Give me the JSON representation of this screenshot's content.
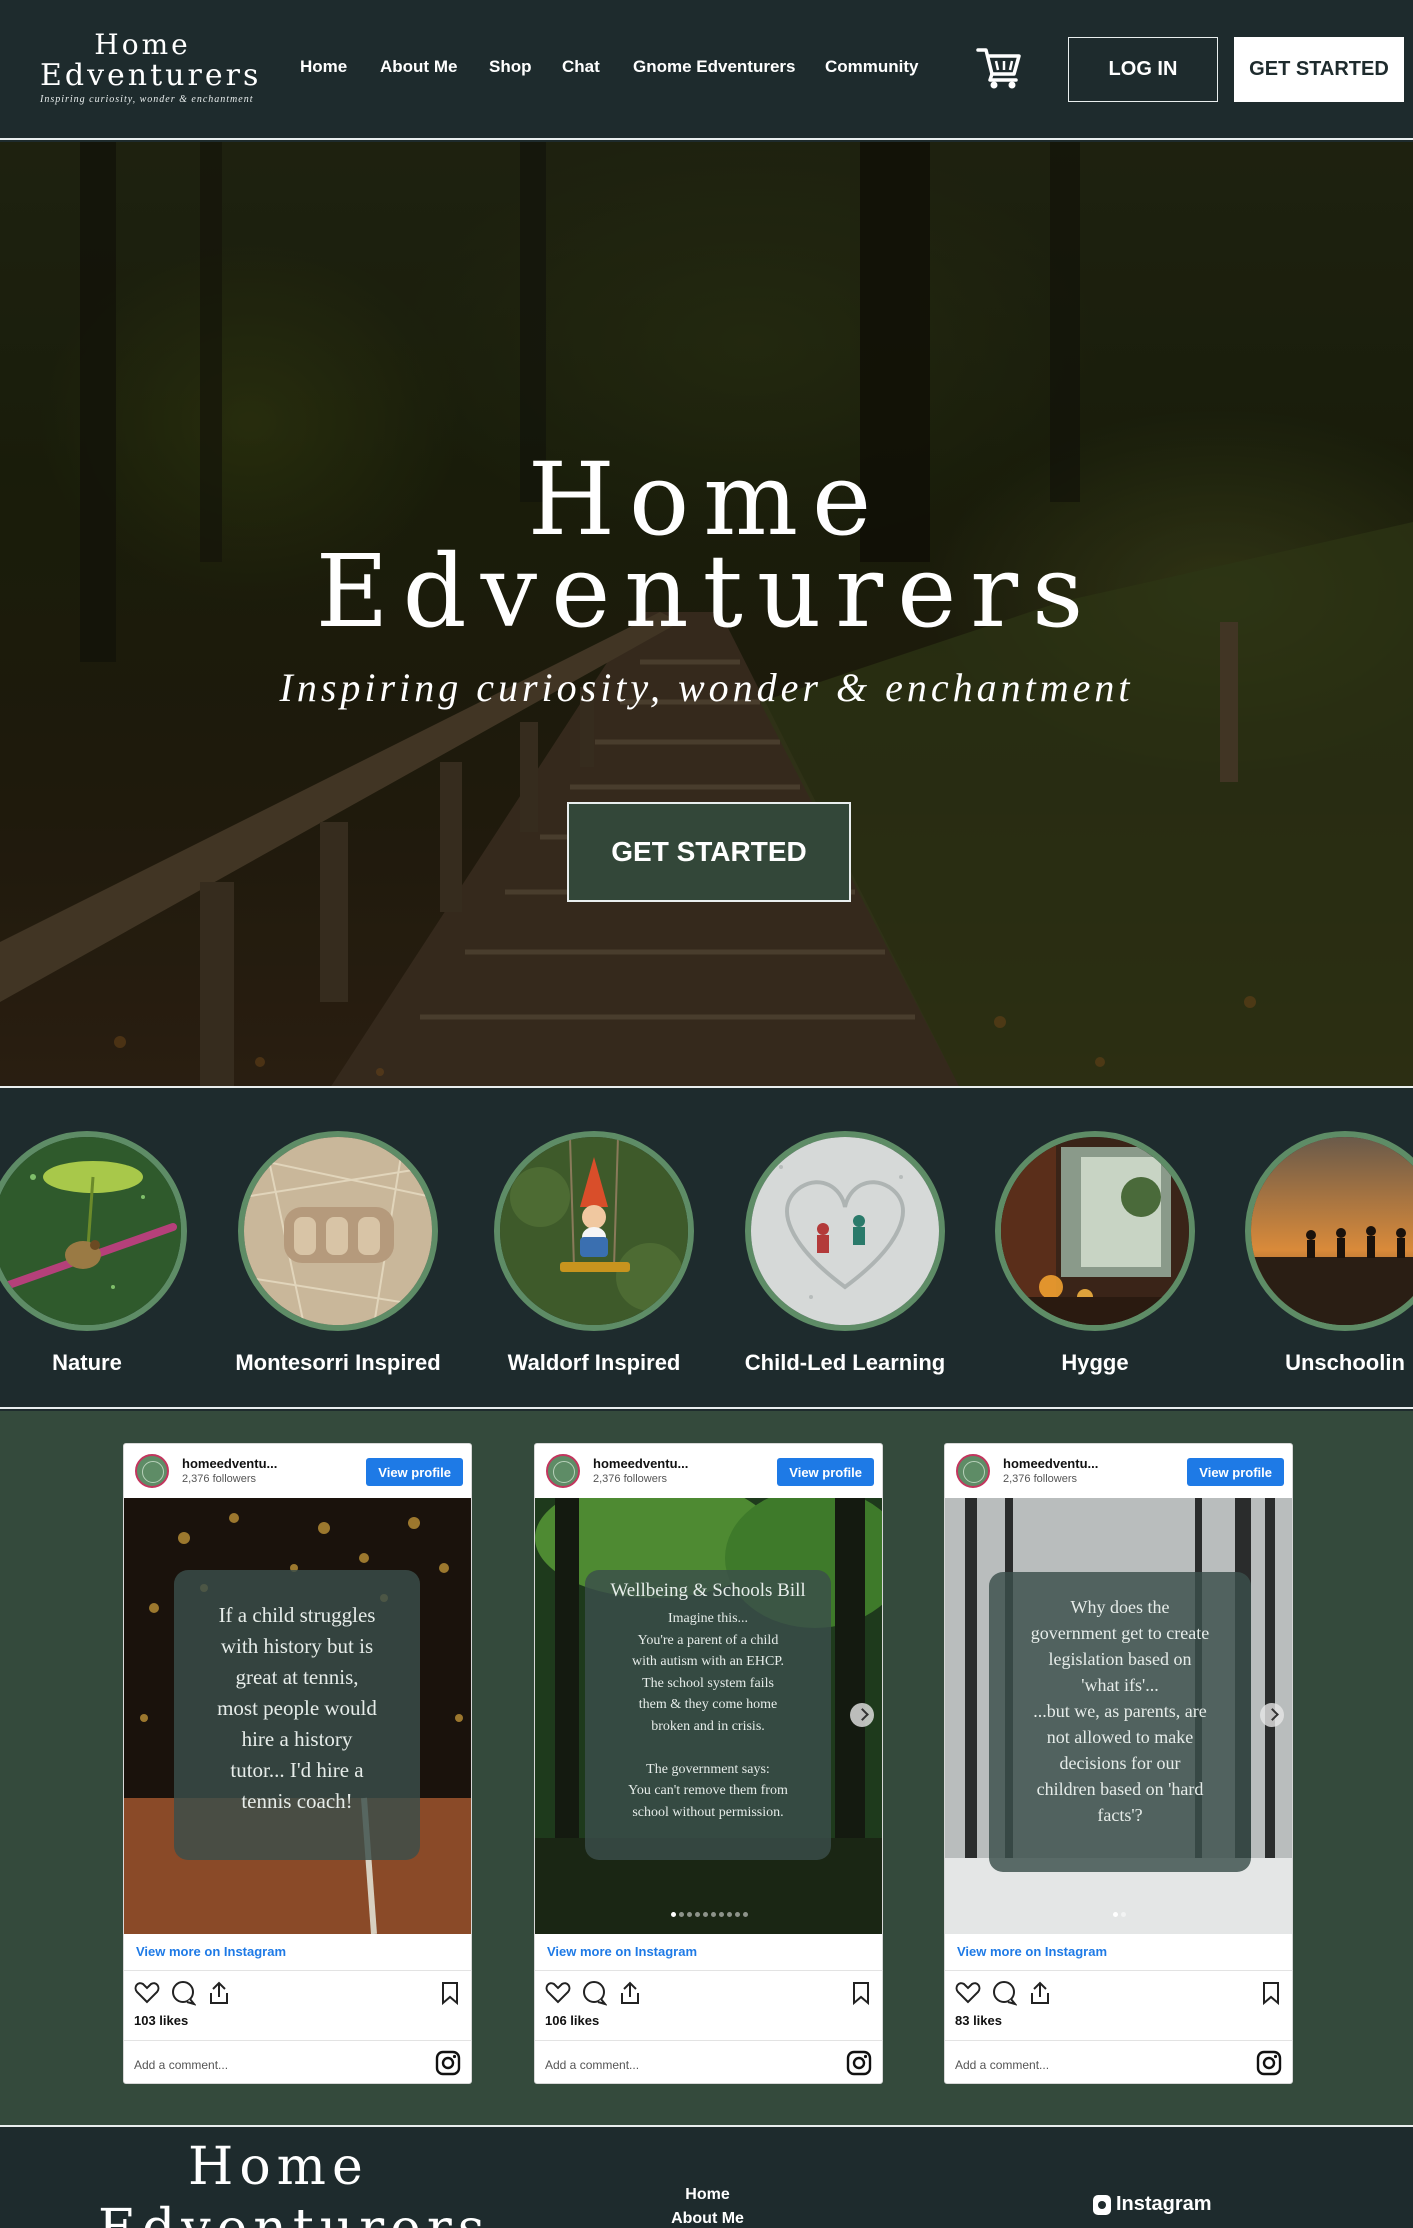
{
  "header": {
    "logo": {
      "line1": "Home",
      "line2": "Edventurers",
      "tagline": "Inspiring curiosity, wonder & enchantment"
    },
    "nav": [
      {
        "label": "Home"
      },
      {
        "label": "About Me"
      },
      {
        "label": "Shop"
      },
      {
        "label": "Chat"
      },
      {
        "label": "Gnome Edventurers"
      },
      {
        "label": "Community"
      }
    ],
    "cart_icon": "shopping-cart-icon",
    "login_label": "LOG IN",
    "get_started_label": "GET STARTED"
  },
  "hero": {
    "title_line1": "Home",
    "title_line2": "Edventurers",
    "subtitle": "Inspiring curiosity, wonder & enchantment",
    "cta_label": "GET STARTED"
  },
  "categories": [
    {
      "label": "Nature"
    },
    {
      "label": "Montesorri Inspired"
    },
    {
      "label": "Waldorf Inspired"
    },
    {
      "label": "Child-Led Learning"
    },
    {
      "label": "Hygge"
    },
    {
      "label": "Unschoolin"
    }
  ],
  "instagram": {
    "posts": [
      {
        "username": "homeedventu...",
        "followers": "2,376 followers",
        "view_profile": "View profile",
        "card_text": "If a child struggles\nwith history but is\ngreat at tennis,\nmost people would\nhire a history\ntutor... I'd hire a\ntennis coach!",
        "view_more": "View more on Instagram",
        "likes": "103 likes",
        "comment_placeholder": "Add a comment..."
      },
      {
        "username": "homeedventu...",
        "followers": "2,376 followers",
        "view_profile": "View profile",
        "card_title": "Wellbeing & Schools Bill",
        "card_text": "Imagine this...\nYou're a parent of a child\nwith autism with an EHCP.\nThe school system fails\nthem & they come home\nbroken and in crisis.\n\nThe government says:\nYou can't remove them from\nschool without permission.",
        "view_more": "View more on Instagram",
        "likes": "106 likes",
        "comment_placeholder": "Add a comment..."
      },
      {
        "username": "homeedventu...",
        "followers": "2,376 followers",
        "view_profile": "View profile",
        "card_text": "Why does the\ngovernment get to create\nlegislation based on\n'what ifs'...\n...but we, as parents, are\nnot allowed to make\ndecisions for our\nchildren based on 'hard\nfacts'?",
        "view_more": "View more on Instagram",
        "likes": "83 likes",
        "comment_placeholder": "Add a comment..."
      }
    ]
  },
  "footer": {
    "logo_line1": "Home",
    "logo_line2": "Edventurers",
    "links": [
      {
        "label": "Home"
      },
      {
        "label": "About Me"
      }
    ],
    "instagram_label": "Instagram"
  },
  "colors": {
    "dark_teal": "#1e2b2d",
    "forest_green": "#344a3c",
    "ring_green": "#5e8c66",
    "instagram_blue": "#1e7ae6"
  }
}
